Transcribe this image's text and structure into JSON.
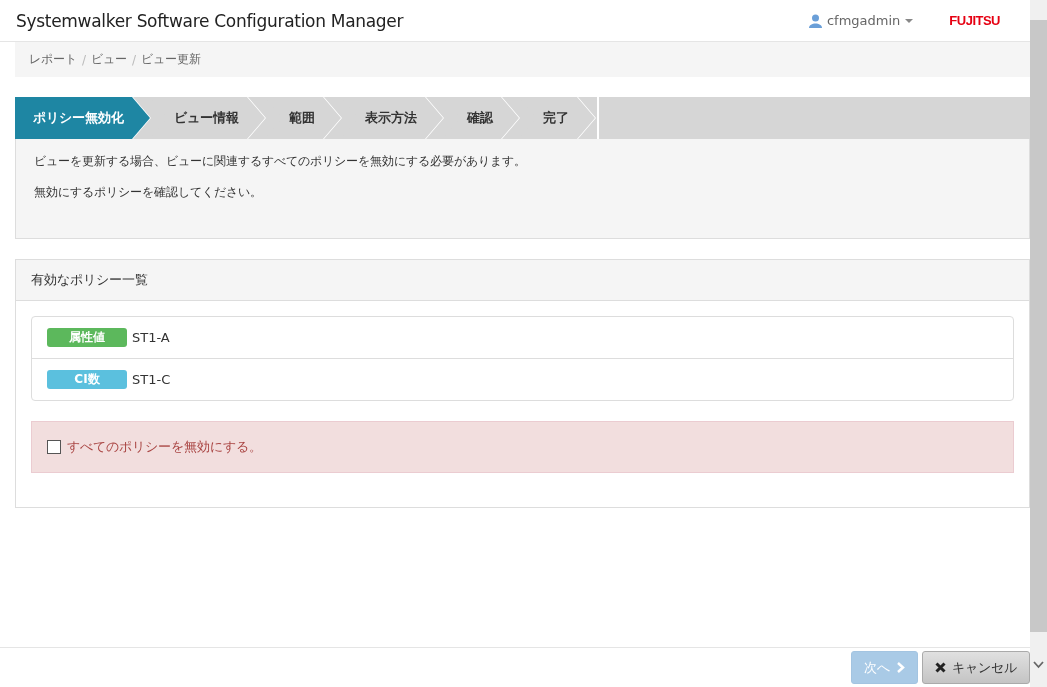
{
  "header": {
    "title": "Systemwalker Software Configuration Manager",
    "user": "cfmgadmin",
    "logo": "FUJITSU"
  },
  "breadcrumb": {
    "separator": "/",
    "items": [
      "レポート",
      "ビュー",
      "ビュー更新"
    ]
  },
  "steps": [
    {
      "label": "ポリシー無効化",
      "selected": true
    },
    {
      "label": "ビュー情報",
      "selected": false
    },
    {
      "label": "範囲",
      "selected": false
    },
    {
      "label": "表示方法",
      "selected": false
    },
    {
      "label": "確認",
      "selected": false
    },
    {
      "label": "完了",
      "selected": false
    }
  ],
  "info": [
    "ビューを更新する場合、ビューに関連するすべてのポリシーを無効にする必要があります。",
    "無効にするポリシーを確認してください。"
  ],
  "panel": {
    "title": "有効なポリシー一覧",
    "policies": [
      {
        "tag": "属性値",
        "color": "#5cb85c",
        "name": "ST1-A"
      },
      {
        "tag": "CI数",
        "color": "#5bc0de",
        "name": "ST1-C"
      }
    ],
    "confirm": {
      "label": "すべてのポリシーを無効にする。",
      "checked": false
    }
  },
  "footer": {
    "next": {
      "label": "次へ",
      "disabled": true
    },
    "cancel": {
      "label": "キャンセル"
    }
  }
}
